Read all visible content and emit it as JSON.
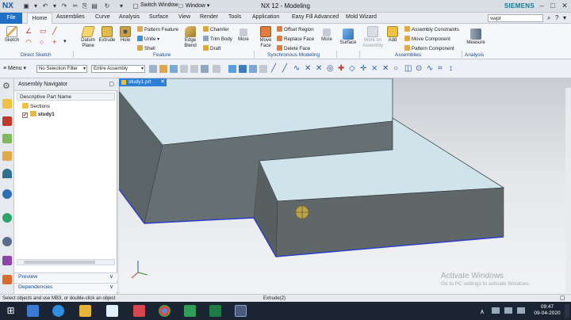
{
  "titlebar": {
    "logo": "NX",
    "title": "NX 12 - Modeling",
    "switch_window": "Switch Window",
    "window_menu": "Window ▾",
    "brand": "SIEMENS"
  },
  "tabs": [
    "File",
    "Home",
    "Assemblies",
    "Curve",
    "Analysis",
    "Surface",
    "View",
    "Render",
    "Tools",
    "Application",
    "Easy Fill Advanced",
    "Mold Wizard"
  ],
  "search": {
    "value": "swpt"
  },
  "ribbon": {
    "sketch": "Sketch",
    "direct_sketch": "Direct Sketch",
    "datum_plane": "Datum Plane",
    "extrude": "Extrude",
    "hole": "Hole",
    "pattern_feature": "Pattern Feature",
    "unite": "Unite",
    "shell": "Shell",
    "edge_blend": "Edge Blend",
    "chamfer": "Chamfer",
    "trim_body": "Trim Body",
    "draft": "Draft",
    "more": "More",
    "feature": "Feature",
    "move_face": "Move Face",
    "offset_region": "Offset Region",
    "replace_face": "Replace Face",
    "delete_face": "Delete Face",
    "more2": "More",
    "synchronous_modeling": "Synchronous Modeling",
    "surface": "Surface",
    "work_on_assembly": "Work on Assembly",
    "add": "Add",
    "assembly_constraints": "Assembly Constraints",
    "move_component": "Move Component",
    "pattern_component": "Pattern Component",
    "assemblies": "Assemblies",
    "measure": "Measure",
    "analysis": "Analysis"
  },
  "toolbar": {
    "menu": "Menu",
    "selection_filter": "No Selection Filter",
    "scope": "Entire Assembly"
  },
  "navigator": {
    "title": "Assembly Navigator",
    "column": "Descriptive Part Name",
    "items": [
      {
        "label": "Sections"
      },
      {
        "label": "study1"
      }
    ],
    "preview": "Preview",
    "dependencies": "Dependencies"
  },
  "viewport": {
    "tab": "study1.prt"
  },
  "status": {
    "left": "Select objects and use MB3, or double-click an object",
    "middle": "Extrude(2)"
  },
  "watermark": {
    "title": "Activate Windows",
    "subtitle": "Go to PC settings to activate Windows."
  },
  "taskbar": {
    "time": "09:47",
    "date": "09-04-2020"
  },
  "colors": {
    "accent": "#1f6fc4",
    "face_top": "#cfe3ea",
    "face_side": "#5f6769",
    "edge": "#2a3cc7"
  }
}
